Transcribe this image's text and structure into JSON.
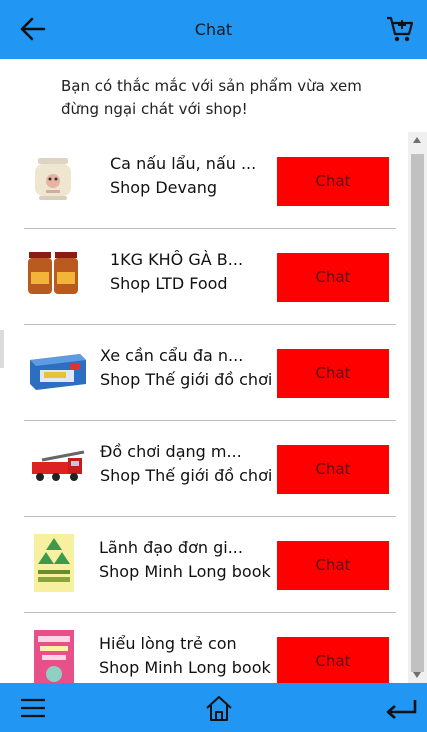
{
  "header": {
    "title": "Chat"
  },
  "intro": {
    "text": "Bạn có thắc mắc với sản phẩm vừa xem đừng ngại chát với shop!"
  },
  "items": [
    {
      "name": "Ca nấu lẩu, nấu ...",
      "shop": "Shop Devang",
      "chat_label": "Chat",
      "image": "rice-cooker-image"
    },
    {
      "name": "1KG KHÔ GÀ B...",
      "shop": "Shop LTD Food",
      "chat_label": "Chat",
      "image": "dried-chicken-jars-image"
    },
    {
      "name": "Xe cần cẩu đa n...",
      "shop": "Shop Thế giới đồ chơi",
      "chat_label": "Chat",
      "image": "crane-toy-box-image"
    },
    {
      "name": "Đồ chơi dạng m...",
      "shop": "Shop Thế giới đồ chơi",
      "chat_label": "Chat",
      "image": "fire-truck-toy-image"
    },
    {
      "name": "Lãnh đạo đơn gi...",
      "shop": "Shop Minh Long book",
      "chat_label": "Chat",
      "image": "leadership-book-image"
    },
    {
      "name": "Hiểu lòng trẻ con",
      "shop": "Shop Minh Long book",
      "chat_label": "Chat",
      "image": "children-book-image"
    }
  ],
  "icons": {
    "back": "arrow-left-icon",
    "cart": "cart-icon",
    "menu": "hamburger-menu-icon",
    "home": "home-icon",
    "return": "return-icon"
  },
  "colors": {
    "bar": "#2196f3",
    "chat_button": "#ff0000"
  }
}
